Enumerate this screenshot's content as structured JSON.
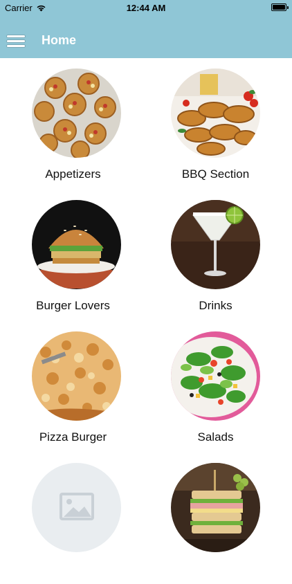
{
  "status_bar": {
    "carrier": "Carrier",
    "time": "12:44 AM",
    "wifi_icon": "wifi-icon",
    "battery_icon": "battery-icon",
    "battery_level": 1.0
  },
  "navbar": {
    "title": "Home",
    "menu_icon": "hamburger-menu-icon",
    "color": "#8fc6d6"
  },
  "categories": [
    {
      "label": "Appetizers",
      "image": "appetizers-photo"
    },
    {
      "label": "BBQ Section",
      "image": "bbq-photo"
    },
    {
      "label": "Burger Lovers",
      "image": "burger-photo"
    },
    {
      "label": "Drinks",
      "image": "drink-photo"
    },
    {
      "label": "Pizza Burger",
      "image": "pizza-photo"
    },
    {
      "label": "Salads",
      "image": "salad-photo"
    },
    {
      "label": "",
      "image": "image-placeholder-icon"
    },
    {
      "label": "",
      "image": "sandwich-photo"
    }
  ]
}
